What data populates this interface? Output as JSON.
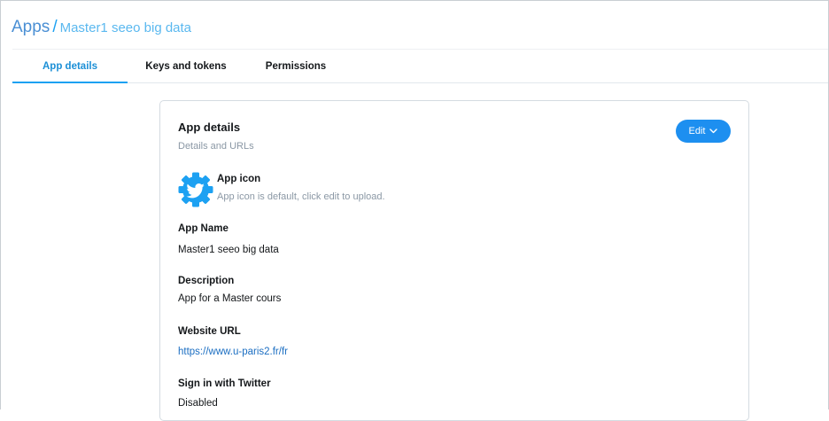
{
  "breadcrumb": {
    "root": "Apps",
    "separator": "/",
    "current": "Master1 seeo big data"
  },
  "tabs": [
    {
      "label": "App details",
      "active": true
    },
    {
      "label": "Keys and tokens",
      "active": false
    },
    {
      "label": "Permissions",
      "active": false
    }
  ],
  "card": {
    "title": "App details",
    "subtitle": "Details and URLs",
    "edit_label": "Edit",
    "app_icon": {
      "icon": "twitter-gear-icon",
      "title": "App icon",
      "description": "App icon is default, click edit to upload."
    },
    "fields": {
      "app_name": {
        "label": "App Name",
        "value": "Master1 seeo big data"
      },
      "description": {
        "label": "Description",
        "value": "App for a Master cours"
      },
      "website_url": {
        "label": "Website URL",
        "value": "https://www.u-paris2.fr/fr"
      },
      "sign_in": {
        "label": "Sign in with Twitter",
        "value": "Disabled"
      }
    }
  },
  "colors": {
    "accent": "#1da1f2",
    "button": "#1d8ff0",
    "muted_text": "#8b98a5",
    "link": "#1b6ec2"
  }
}
